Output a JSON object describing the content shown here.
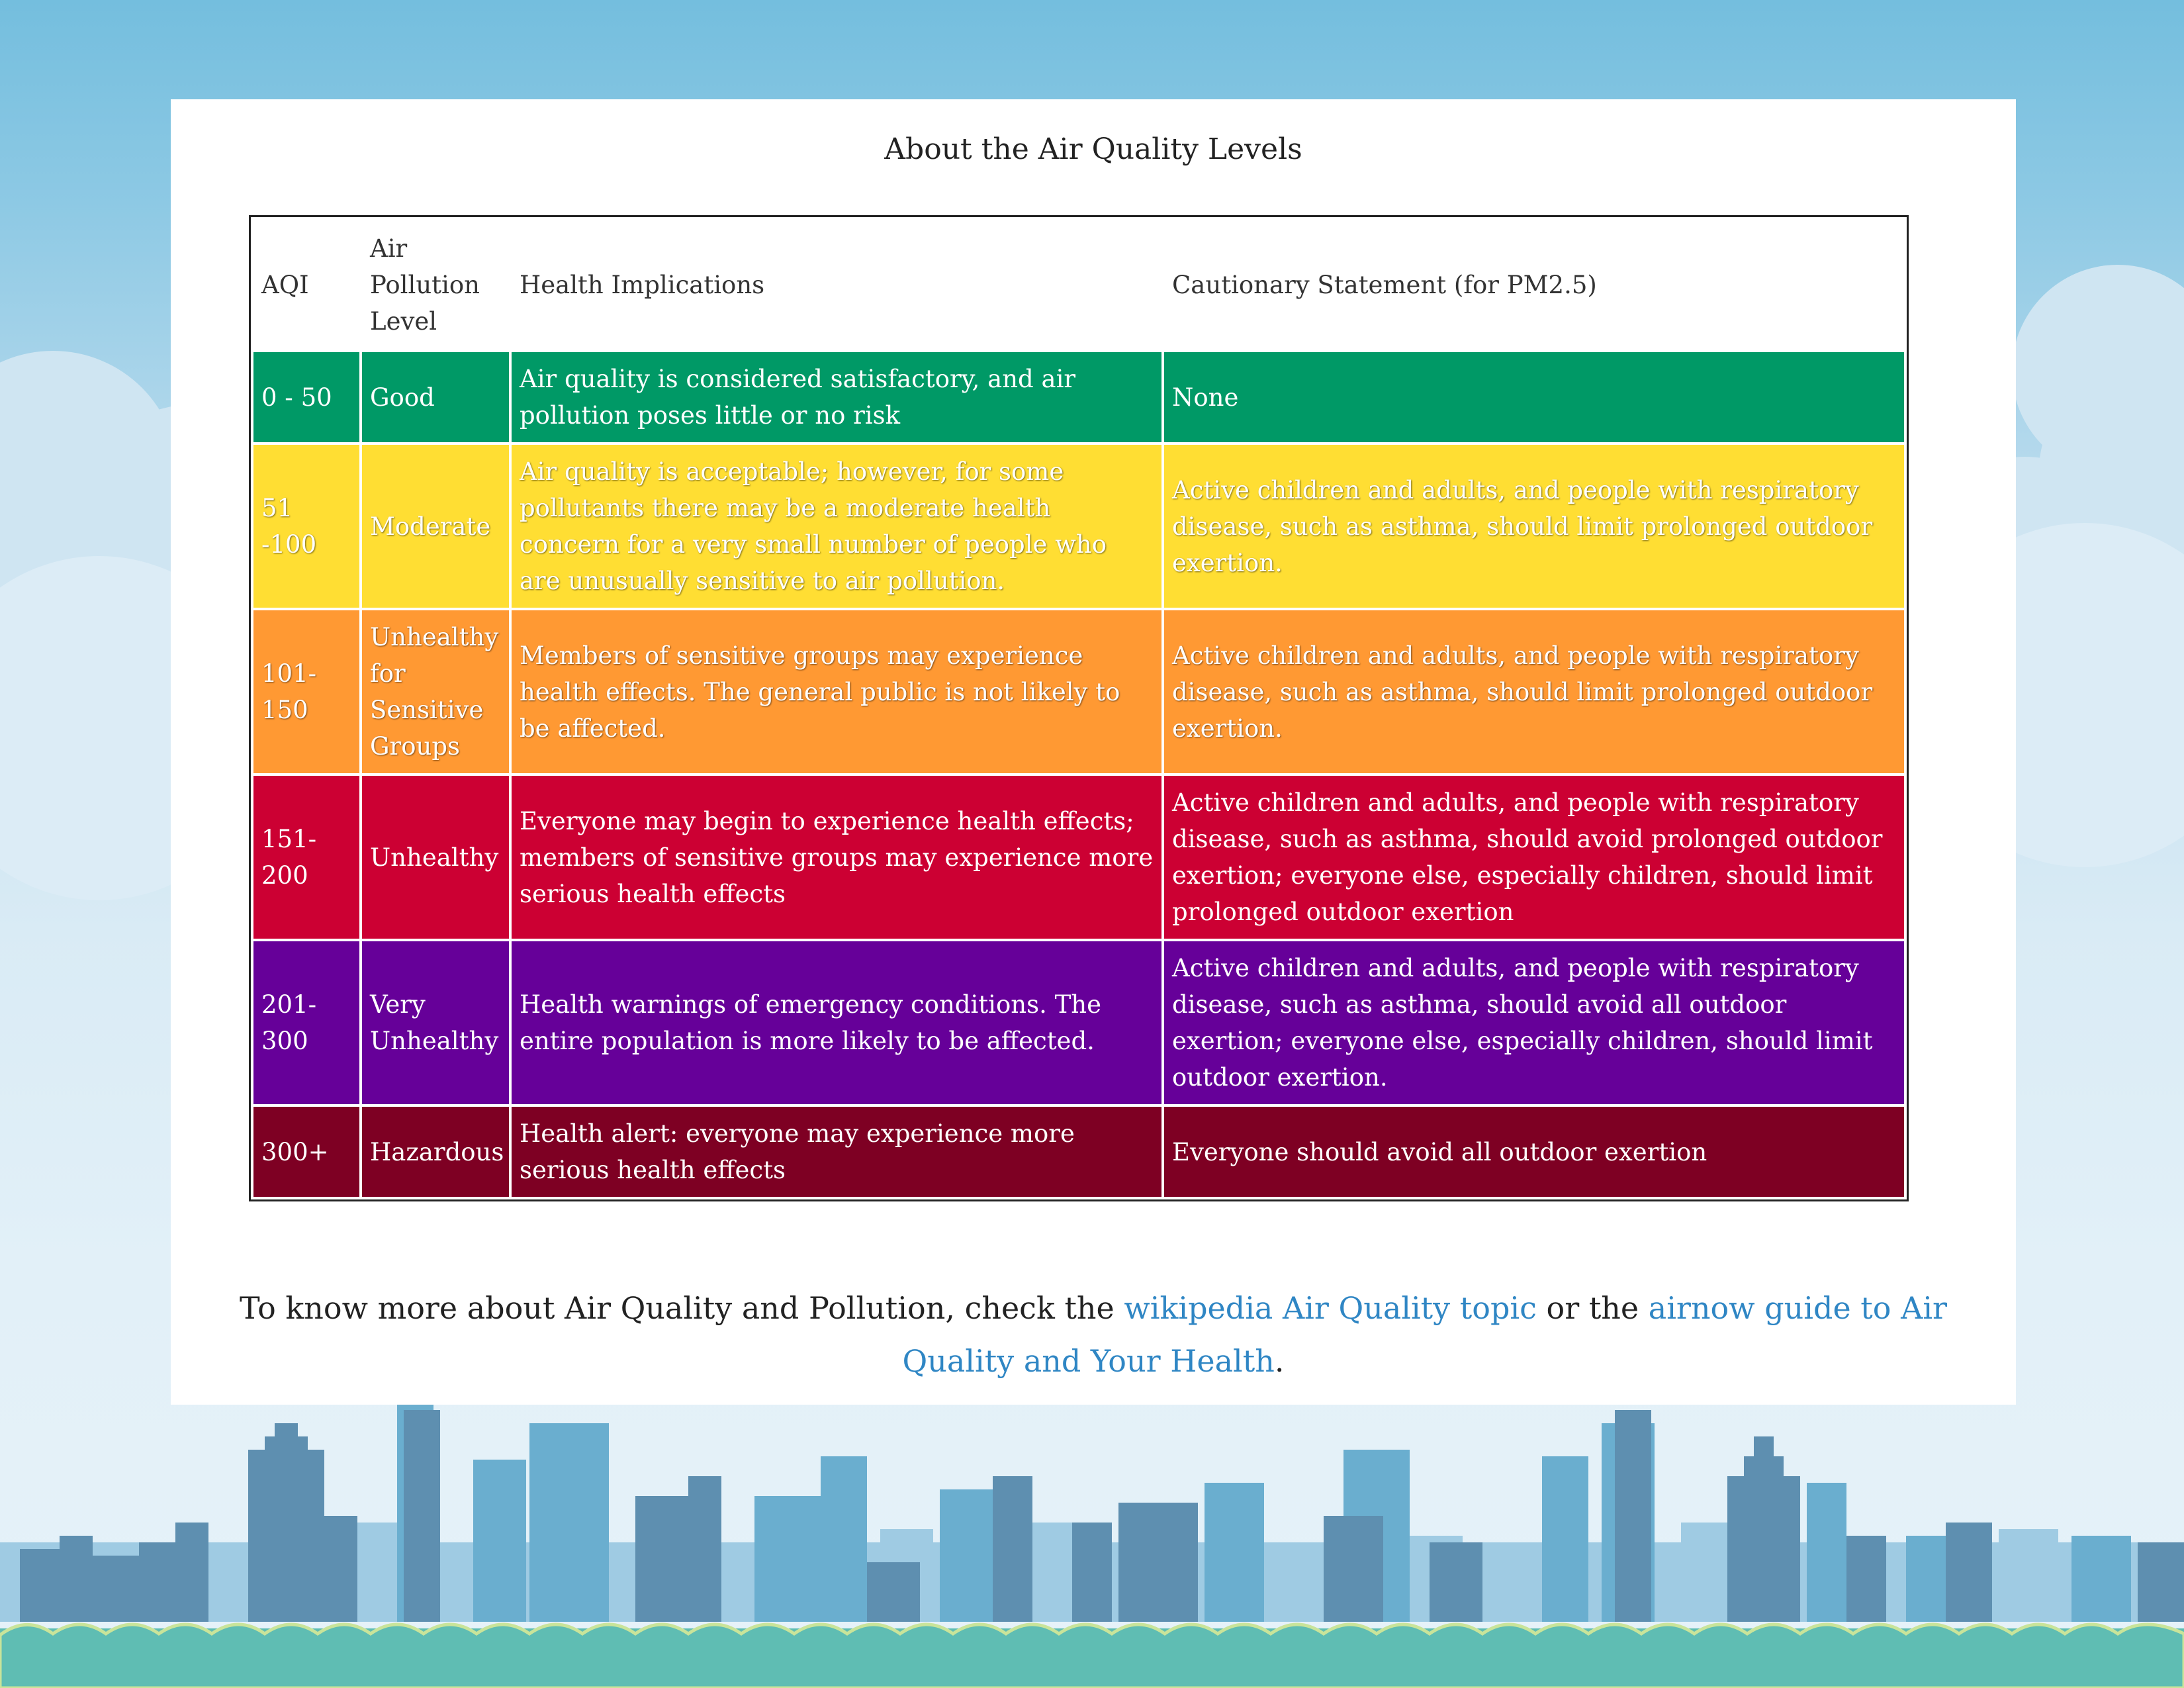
{
  "page": {
    "title": "About the Air Quality Levels"
  },
  "table": {
    "headers": {
      "aqi": "AQI",
      "level": "Air Pollution Level",
      "health": "Health Implications",
      "caution": "Cautionary Statement (for PM2.5)"
    },
    "rows": [
      {
        "aqi": "0 - 50",
        "level": "Good",
        "health": "Air quality is considered satisfactory, and air pollution poses little or no risk",
        "caution": "None",
        "color": "#009966"
      },
      {
        "aqi": "51 -100",
        "level": "Moderate",
        "health": "Air quality is acceptable; however, for some pollutants there may be a moderate health concern for a very small number of people who are unusually sensitive to air pollution.",
        "caution": "Active children and adults, and people with respiratory disease, such as asthma, should limit prolonged outdoor exertion.",
        "color": "#ffde33"
      },
      {
        "aqi": "101-150",
        "level": "Unhealthy for Sensitive Groups",
        "health": "Members of sensitive groups may experience health effects. The general public is not likely to be affected.",
        "caution": "Active children and adults, and people with respiratory disease, such as asthma, should limit prolonged outdoor exertion.",
        "color": "#ff9933"
      },
      {
        "aqi": "151-200",
        "level": "Unhealthy",
        "health": "Everyone may begin to experience health effects; members of sensitive groups may experience more serious health effects",
        "caution": "Active children and adults, and people with respiratory disease, such as asthma, should avoid prolonged outdoor exertion; everyone else, especially children, should limit prolonged outdoor exertion",
        "color": "#cc0033"
      },
      {
        "aqi": "201-300",
        "level": "Very Unhealthy",
        "health": "Health warnings of emergency conditions. The entire population is more likely to be affected.",
        "caution": "Active children and adults, and people with respiratory disease, such as asthma, should avoid all outdoor exertion; everyone else, especially children, should limit outdoor exertion.",
        "color": "#660099"
      },
      {
        "aqi": "300+",
        "level": "Hazardous",
        "health": "Health alert: everyone may experience more serious health effects",
        "caution": "Everyone should avoid all outdoor exertion",
        "color": "#7e0023"
      }
    ]
  },
  "footer": {
    "text_before": "To know more about Air Quality and Pollution, check the ",
    "link1": "wikipedia Air Quality topic",
    "text_middle": " or the ",
    "link2": "airnow guide to Air Quality and Your Health",
    "text_after": "."
  },
  "colors": {
    "link": "#2f86c4",
    "sky_top": "#74bede",
    "ground": "#5fbdb3"
  }
}
